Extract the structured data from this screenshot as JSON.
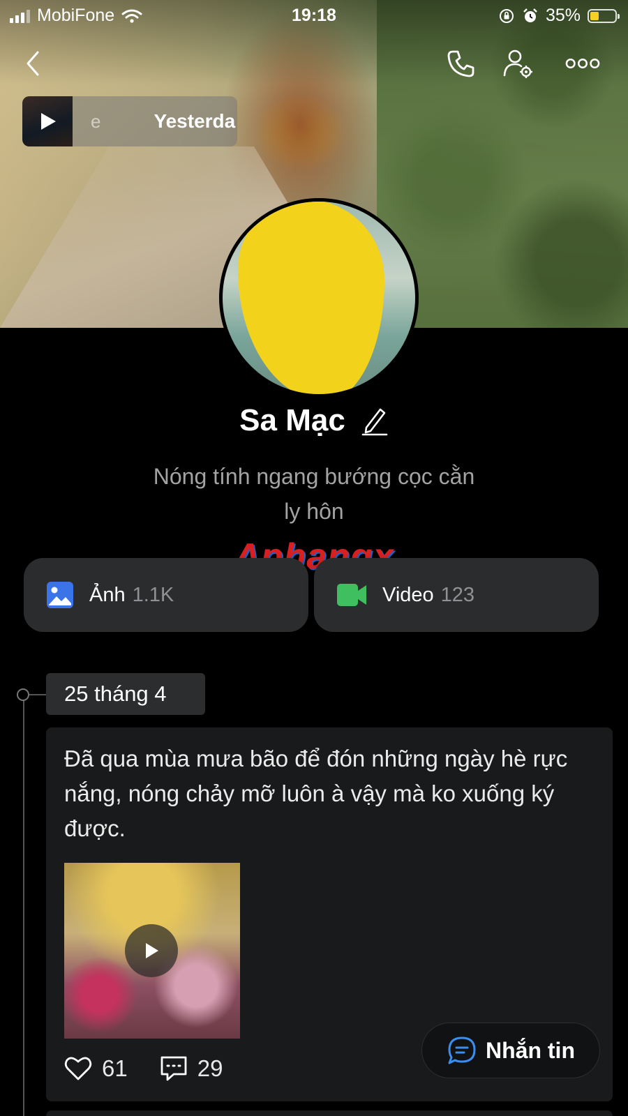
{
  "status_bar": {
    "carrier": "MobiFone",
    "time": "19:18",
    "battery_percent": "35%",
    "battery_level": 0.35,
    "battery_color": "#f5d02a"
  },
  "top_nav": {
    "back_icon": "chevron-left-icon",
    "call_icon": "phone-icon",
    "settings_icon": "user-settings-icon",
    "more_icon": "more-dots-icon"
  },
  "story": {
    "partial_text": "e",
    "label": "Yesterda"
  },
  "profile": {
    "name": "Sa Mạc",
    "bio_line1": "Nóng tính ngang bướng cọc cằn",
    "bio_line2": "ly hôn"
  },
  "watermark": "Aphangx",
  "media": {
    "photos": {
      "label": "Ảnh",
      "count": "1.1K",
      "icon": "image-icon",
      "color": "#3b74e8"
    },
    "videos": {
      "label": "Video",
      "count": "123",
      "icon": "video-camera-icon",
      "color": "#3fbf5f"
    }
  },
  "timeline": {
    "date": "25 tháng 4",
    "post": {
      "text": "Đã qua mùa mưa bão để đón những ngày hè rực nắng, nóng chảy mỡ luôn à vậy mà ko xuống ký được.",
      "likes": "61",
      "comments": "29"
    }
  },
  "message_button": {
    "label": "Nhắn tin",
    "color": "#3b8ef0"
  }
}
